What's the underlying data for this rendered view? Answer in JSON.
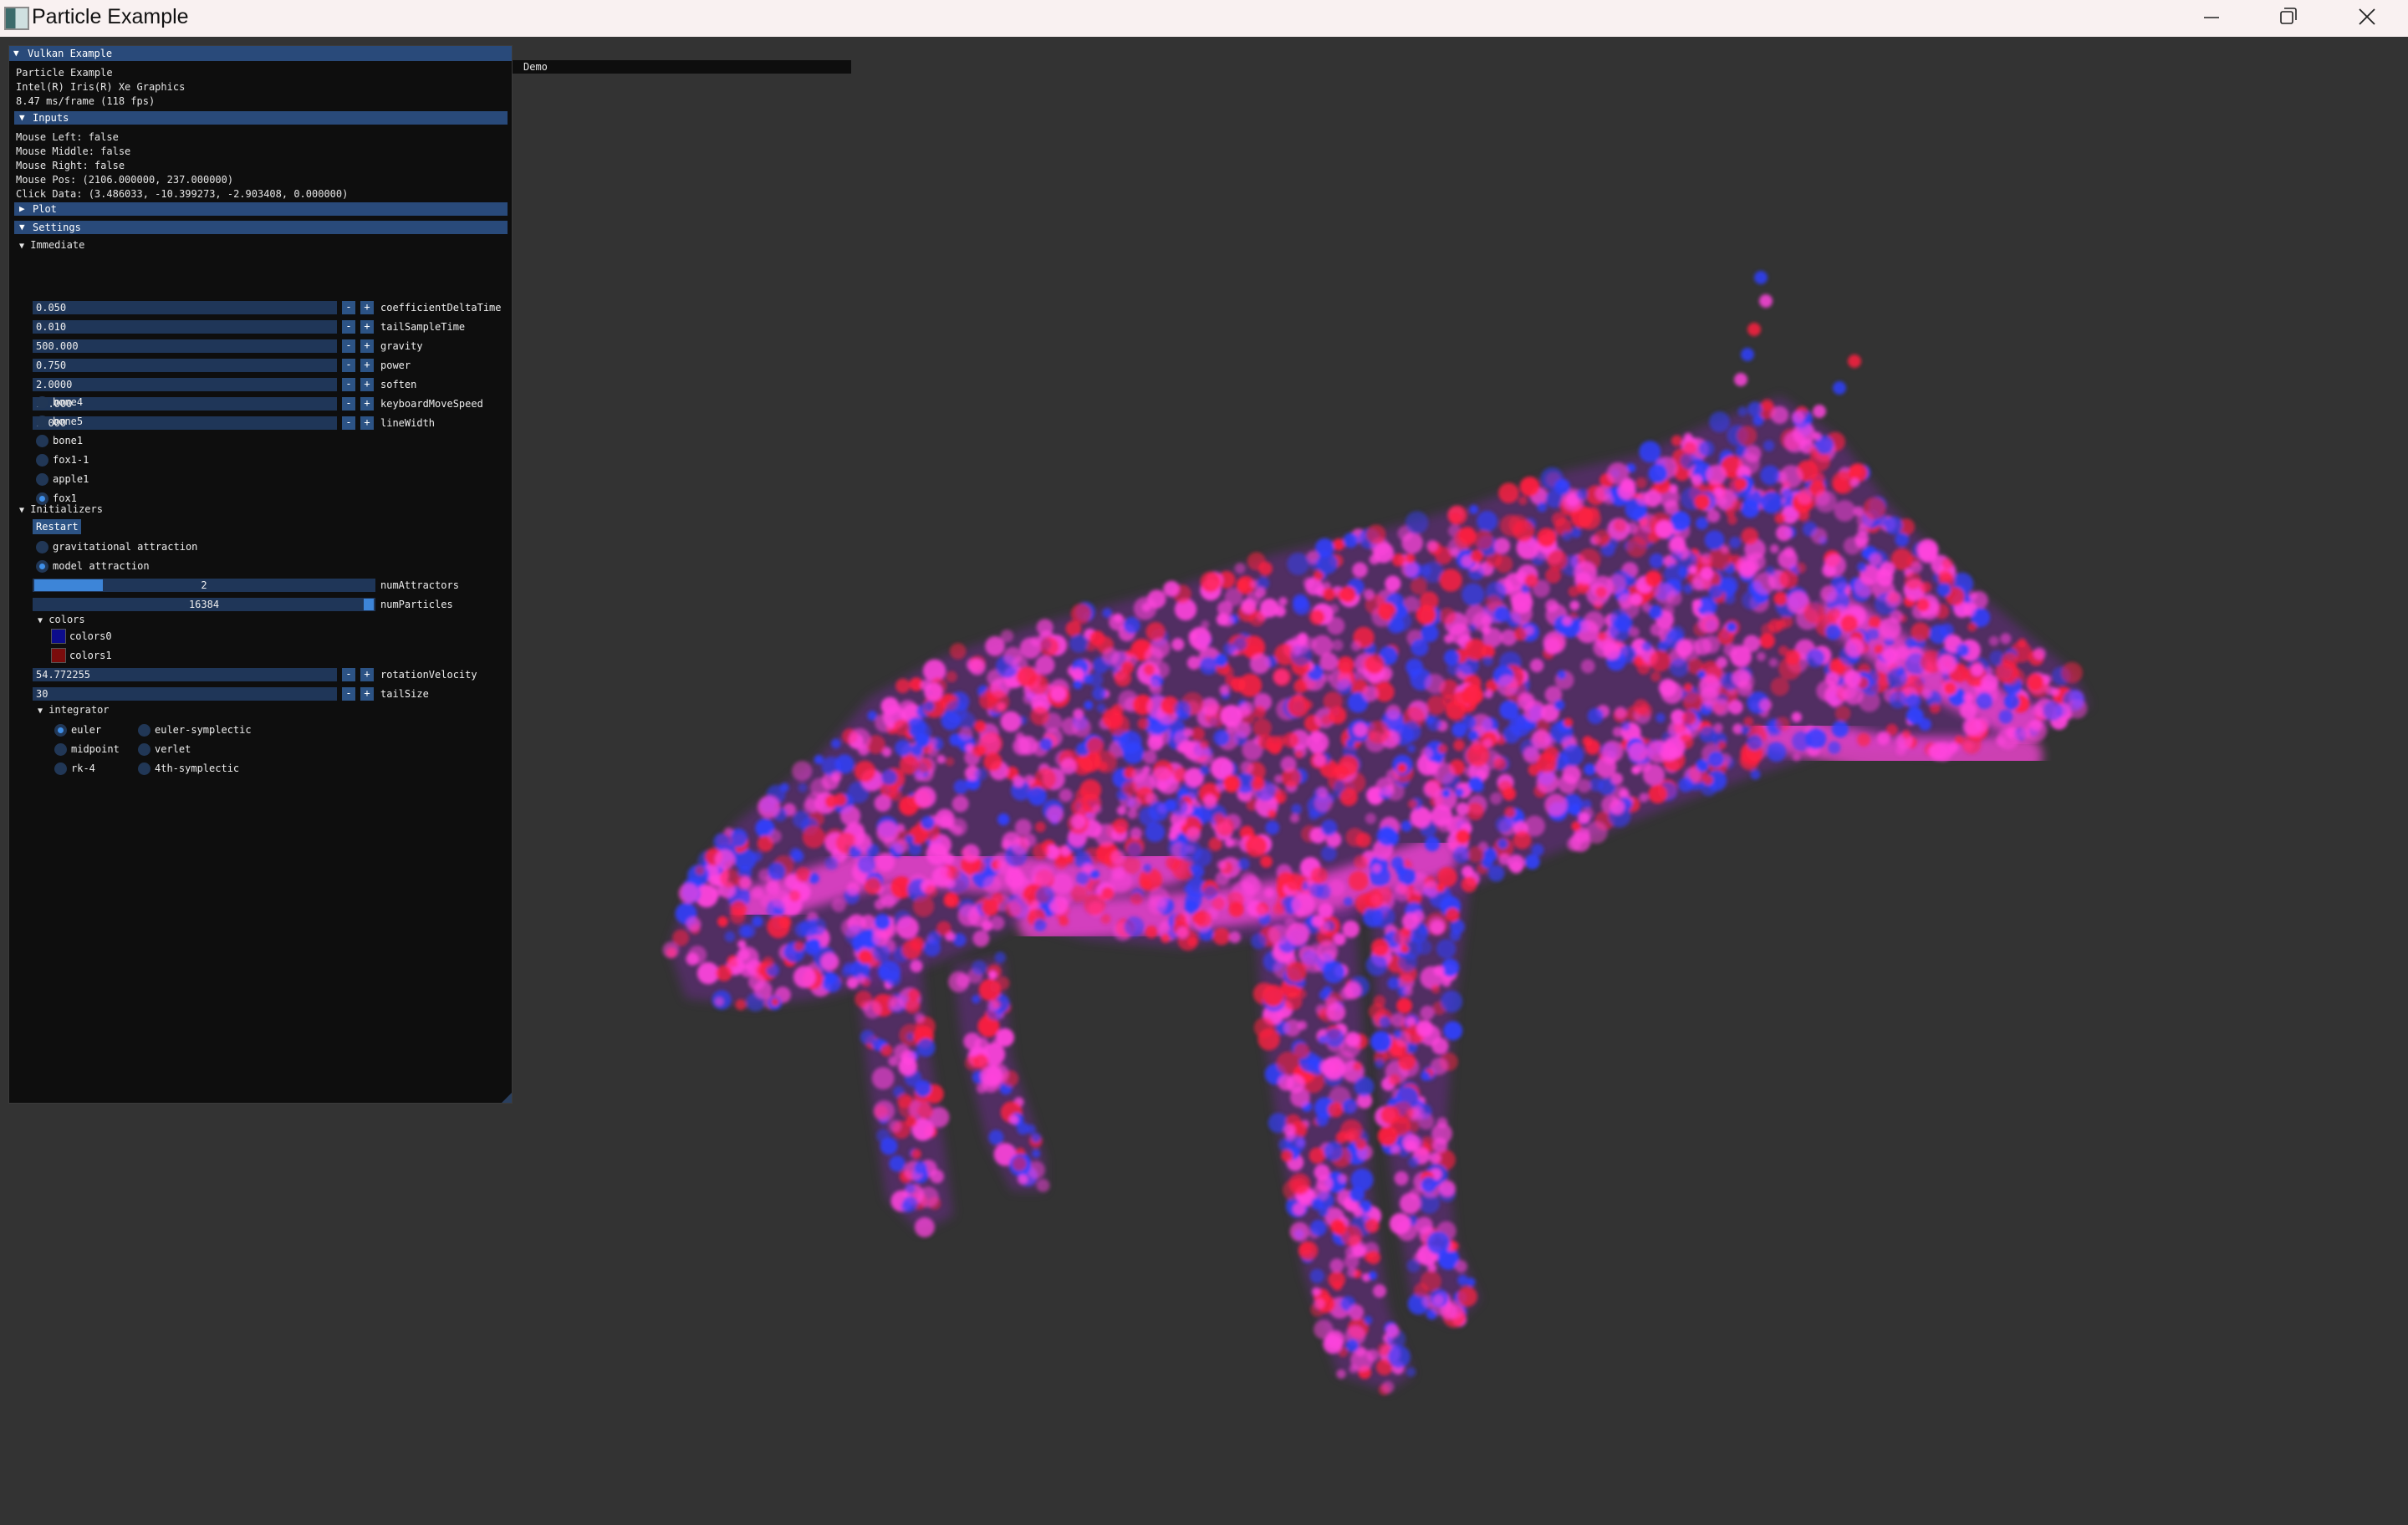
{
  "window": {
    "title": "Particle Example",
    "icons": {
      "app": "app-icon",
      "minimize": "minimize-icon",
      "maximize": "restore-icon",
      "close": "close-icon"
    }
  },
  "demo_window": {
    "title": "Demo"
  },
  "panel": {
    "title": "Vulkan Example",
    "info": {
      "app_name": "Particle Example",
      "gpu": "Intel(R) Iris(R) Xe Graphics",
      "frame_time": "8.47 ms/frame (118 fps)"
    },
    "inputs": {
      "header": "Inputs",
      "mouse_left": "Mouse Left: false",
      "mouse_middle": "Mouse Middle: false",
      "mouse_right": "Mouse Right: false",
      "mouse_pos": "Mouse Pos: (2106.000000, 237.000000)",
      "click_data": "Click Data: (3.486033, -10.399273, -2.903408, 0.000000)"
    },
    "plot": {
      "header": "Plot"
    },
    "settings": {
      "header": "Settings",
      "immediate": {
        "header": "Immediate",
        "fields": [
          {
            "value": "0.050",
            "label": "coefficientDeltaTime"
          },
          {
            "value": "0.010",
            "label": "tailSampleTime"
          },
          {
            "value": "500.000",
            "label": "gravity"
          },
          {
            "value": "0.750",
            "label": "power"
          },
          {
            "value": "2.0000",
            "label": "soften"
          },
          {
            "value": "10.000",
            "label": "keyboardMoveSpeed"
          },
          {
            "value": "1.000",
            "label": "lineWidth"
          }
        ],
        "models": [
          {
            "label": "bone4",
            "selected": false
          },
          {
            "label": "bone5",
            "selected": false
          },
          {
            "label": "bone1",
            "selected": false
          },
          {
            "label": "fox1-1",
            "selected": false
          },
          {
            "label": "apple1",
            "selected": false
          },
          {
            "label": "fox1",
            "selected": true
          }
        ]
      },
      "initializers": {
        "header": "Initializers",
        "restart_label": "Restart",
        "attraction": [
          {
            "label": "gravitational attraction",
            "selected": false
          },
          {
            "label": "model attraction",
            "selected": true
          }
        ],
        "num_attractors": {
          "value": "2",
          "label": "numAttractors",
          "fill": 0.2
        },
        "num_particles": {
          "value": "16384",
          "label": "numParticles",
          "fill": 1.0
        },
        "colors": {
          "header": "colors",
          "items": [
            {
              "label": "colors0",
              "color": "#0c0c8c"
            },
            {
              "label": "colors1",
              "color": "#7a0c0c"
            }
          ]
        },
        "rotation_velocity": {
          "value": "54.772255",
          "label": "rotationVelocity"
        },
        "tail_size": {
          "value": "30",
          "label": "tailSize"
        },
        "integrator": {
          "header": "integrator",
          "options": [
            {
              "label": "euler",
              "selected": true
            },
            {
              "label": "euler-symplectic",
              "selected": false
            },
            {
              "label": "midpoint",
              "selected": false
            },
            {
              "label": "verlet",
              "selected": false
            },
            {
              "label": "rk-4",
              "selected": false
            },
            {
              "label": "4th-symplectic",
              "selected": false
            }
          ]
        }
      },
      "stepper_minus": "-",
      "stepper_plus": "+"
    }
  },
  "theme": {
    "viewport_bg": "#333333",
    "panel_bg": "#0e0e0e",
    "header_bg": "#294a7a",
    "particle_pink": "#ff44dd",
    "particle_red": "#ff2040",
    "particle_blue": "#3040ff"
  }
}
